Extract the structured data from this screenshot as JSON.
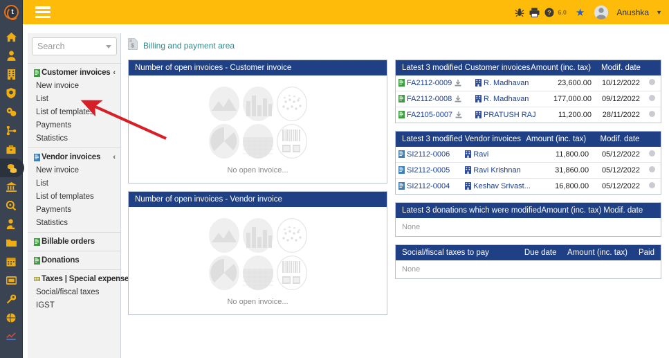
{
  "brand": {
    "logo_letter": "t",
    "header_color": "#ffbb0a",
    "panel_header_color": "#1f4084",
    "accent_link": "#2d8b8b"
  },
  "topbar": {
    "menu_toggle": "hamburger-menu",
    "version": "6.0",
    "user_name": "Anushka",
    "caret": "⌄"
  },
  "sidebar_rail": {
    "items": [
      {
        "name": "home-icon",
        "active": false
      },
      {
        "name": "user-icon",
        "active": false
      },
      {
        "name": "building-icon",
        "active": false
      },
      {
        "name": "globe-shield-icon",
        "active": false
      },
      {
        "name": "products-icon",
        "active": false
      },
      {
        "name": "share-nodes-icon",
        "active": false
      },
      {
        "name": "briefcase-icon",
        "active": false
      },
      {
        "name": "money-stack-icon",
        "active": true
      },
      {
        "name": "bank-icon",
        "active": false
      },
      {
        "name": "search-circle-icon",
        "active": false
      },
      {
        "name": "employee-icon",
        "active": false
      },
      {
        "name": "folder-icon",
        "active": false
      },
      {
        "name": "calendar-icon",
        "active": false
      },
      {
        "name": "ticket-icon",
        "active": false
      },
      {
        "name": "wrench-icon",
        "active": false
      },
      {
        "name": "globe-icon",
        "active": false
      },
      {
        "name": "chart-icon",
        "active": false
      }
    ]
  },
  "search": {
    "placeholder": "Search",
    "value": "Search"
  },
  "menu": {
    "sections": [
      {
        "label": "Customer invoices",
        "icon": "green-invoice-icon",
        "icon_color": "#3f9b3f",
        "chevron": "‹",
        "links": [
          "New invoice",
          "List",
          "List of templates",
          "Payments",
          "Statistics"
        ]
      },
      {
        "label": "Vendor invoices",
        "icon": "blue-invoice-icon",
        "icon_color": "#3f7fb5",
        "chevron": "‹",
        "links": [
          "New invoice",
          "List",
          "List of templates",
          "Payments",
          "Statistics"
        ]
      },
      {
        "label": "Billable orders",
        "icon": "green-invoice-icon",
        "icon_color": "#3f9b3f",
        "chevron": "",
        "links": []
      },
      {
        "label": "Donations",
        "icon": "green-invoice-icon",
        "icon_color": "#3f9b3f",
        "chevron": "",
        "links": []
      },
      {
        "label": "Taxes | Special expenses",
        "icon": "olive-tax-icon",
        "icon_color": "#a9a83c",
        "chevron": "‹",
        "links": [
          "Social/fiscal taxes",
          "IGST"
        ]
      }
    ]
  },
  "breadcrumb": {
    "icon": "invoice-dollar-icon",
    "text": "Billing and payment area"
  },
  "charts": [
    {
      "title": "Number of open invoices - Customer invoice",
      "empty_text": "No open invoice...",
      "placeholders": [
        "area-chart-icon",
        "bar-chart-icon",
        "scatter-chart-icon",
        "pie-chart-icon",
        "filled-area-icon",
        "barcode-icon"
      ]
    },
    {
      "title": "Number of open invoices - Vendor invoice",
      "empty_text": "No open invoice...",
      "placeholders": [
        "area-chart-icon",
        "bar-chart-icon",
        "scatter-chart-icon",
        "pie-chart-icon",
        "filled-area-icon",
        "barcode-icon"
      ]
    }
  ],
  "tables": {
    "customer_invoices": {
      "title": "Latest 3 modified Customer invoices",
      "col_amount": "Amount (inc. tax)",
      "col_date": "Modif. date",
      "rows": [
        {
          "id": "FA2112-0009",
          "party": "R. Madhavan",
          "amount": "23,600.00",
          "date": "10/12/2022",
          "status": "grey",
          "has_download": true
        },
        {
          "id": "FA2112-0008",
          "party": "R. Madhavan",
          "amount": "177,000.00",
          "date": "09/12/2022",
          "status": "grey",
          "has_download": true
        },
        {
          "id": "FA2105-0007",
          "party": "PRATUSH RAJ",
          "amount": "11,200.00",
          "date": "28/11/2022",
          "status": "grey",
          "has_download": true
        }
      ]
    },
    "vendor_invoices": {
      "title": "Latest 3 modified Vendor invoices",
      "col_amount": "Amount (inc. tax)",
      "col_date": "Modif. date",
      "rows": [
        {
          "id": "SI2112-0006",
          "party": "Ravi",
          "amount": "11,800.00",
          "date": "05/12/2022",
          "status": "grey",
          "has_download": false
        },
        {
          "id": "SI2112-0005",
          "party": "Ravi Krishnan",
          "amount": "31,860.00",
          "date": "05/12/2022",
          "status": "grey",
          "has_download": false
        },
        {
          "id": "SI2112-0004",
          "party": "Keshav Srivast...",
          "amount": "16,800.00",
          "date": "05/12/2022",
          "status": "grey",
          "has_download": false
        }
      ]
    },
    "donations": {
      "title": "Latest 3 donations which were modified",
      "col_amount": "Amount (inc. tax)",
      "col_date": "Modif. date",
      "empty_text": "None"
    },
    "taxes": {
      "title": "Social/fiscal taxes to pay",
      "col_due": "Due date",
      "col_amount": "Amount (inc. tax)",
      "col_paid": "Paid",
      "empty_text": "None"
    }
  }
}
